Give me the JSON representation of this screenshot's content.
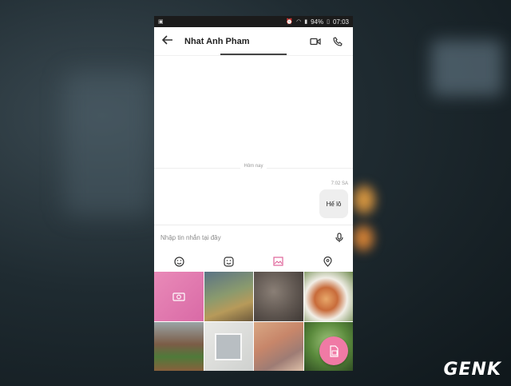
{
  "status_bar": {
    "battery": "94%",
    "time": "07:03"
  },
  "header": {
    "contact_name": "Nhat Anh Pham",
    "icons": [
      "back-arrow-icon",
      "video-call-icon",
      "phone-icon"
    ]
  },
  "chat": {
    "date_divider": "Hôm nay",
    "messages": [
      {
        "time": "7:02 SA",
        "text": "Hế lô",
        "sender": "self"
      }
    ]
  },
  "composer": {
    "placeholder": "Nhập tin nhắn tại đây",
    "icons": [
      "microphone-icon"
    ]
  },
  "toolbar": {
    "items": [
      "emoji-icon",
      "sticker-icon",
      "gallery-icon",
      "location-icon"
    ],
    "active_color": "#e0649a"
  },
  "gallery": {
    "items": [
      "camera-tile",
      "photo",
      "photo",
      "photo",
      "photo",
      "photo",
      "photo",
      "photo"
    ]
  },
  "watermark": "GENK",
  "colors": {
    "accent": "#f07aa5",
    "status_bar": "#1b1b1b"
  }
}
